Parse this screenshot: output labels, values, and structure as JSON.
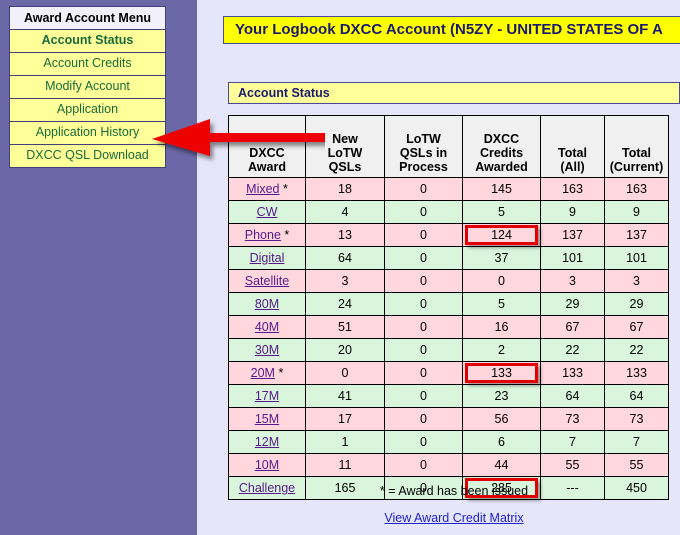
{
  "sidebar": {
    "header": "Award Account Menu",
    "items": [
      {
        "label": "Account Status",
        "bold": true
      },
      {
        "label": "Account Credits",
        "bold": false
      },
      {
        "label": "Modify Account",
        "bold": false
      },
      {
        "label": "Application",
        "bold": false
      },
      {
        "label": "Application History",
        "bold": false
      },
      {
        "label": "DXCC QSL Download",
        "bold": false
      }
    ]
  },
  "main": {
    "title": "Your Logbook DXCC Account (N5ZY - UNITED STATES OF A",
    "section_title": "Account Status",
    "footnote": "* = Award has been issued",
    "matrix_link": "View Award Credit Matrix",
    "columns": [
      "DXCC Award",
      "New LoTW QSLs",
      "LoTW QSLs in Process",
      "DXCC Credits Awarded",
      "Total (All)",
      "Total (Current)"
    ],
    "column_lines": [
      [
        "DXCC",
        "Award"
      ],
      [
        "New",
        "LoTW",
        "QSLs"
      ],
      [
        "LoTW",
        "QSLs in",
        "Process"
      ],
      [
        "DXCC",
        "Credits",
        "Awarded"
      ],
      [
        "Total",
        "(All)"
      ],
      [
        "Total",
        "(Current)"
      ]
    ],
    "rows": [
      {
        "award": "Mixed",
        "issued": true,
        "new_lotw": "18",
        "in_process": "0",
        "credits": "145",
        "total_all": "163",
        "total_current": "163",
        "highlight": false
      },
      {
        "award": "CW",
        "issued": false,
        "new_lotw": "4",
        "in_process": "0",
        "credits": "5",
        "total_all": "9",
        "total_current": "9",
        "highlight": false
      },
      {
        "award": "Phone",
        "issued": true,
        "new_lotw": "13",
        "in_process": "0",
        "credits": "124",
        "total_all": "137",
        "total_current": "137",
        "highlight": true
      },
      {
        "award": "Digital",
        "issued": false,
        "new_lotw": "64",
        "in_process": "0",
        "credits": "37",
        "total_all": "101",
        "total_current": "101",
        "highlight": false
      },
      {
        "award": "Satellite",
        "issued": false,
        "new_lotw": "3",
        "in_process": "0",
        "credits": "0",
        "total_all": "3",
        "total_current": "3",
        "highlight": false
      },
      {
        "award": "80M",
        "issued": false,
        "new_lotw": "24",
        "in_process": "0",
        "credits": "5",
        "total_all": "29",
        "total_current": "29",
        "highlight": false
      },
      {
        "award": "40M",
        "issued": false,
        "new_lotw": "51",
        "in_process": "0",
        "credits": "16",
        "total_all": "67",
        "total_current": "67",
        "highlight": false
      },
      {
        "award": "30M",
        "issued": false,
        "new_lotw": "20",
        "in_process": "0",
        "credits": "2",
        "total_all": "22",
        "total_current": "22",
        "highlight": false
      },
      {
        "award": "20M",
        "issued": true,
        "new_lotw": "0",
        "in_process": "0",
        "credits": "133",
        "total_all": "133",
        "total_current": "133",
        "highlight": true
      },
      {
        "award": "17M",
        "issued": false,
        "new_lotw": "41",
        "in_process": "0",
        "credits": "23",
        "total_all": "64",
        "total_current": "64",
        "highlight": false
      },
      {
        "award": "15M",
        "issued": false,
        "new_lotw": "17",
        "in_process": "0",
        "credits": "56",
        "total_all": "73",
        "total_current": "73",
        "highlight": false
      },
      {
        "award": "12M",
        "issued": false,
        "new_lotw": "1",
        "in_process": "0",
        "credits": "6",
        "total_all": "7",
        "total_current": "7",
        "highlight": false
      },
      {
        "award": "10M",
        "issued": false,
        "new_lotw": "11",
        "in_process": "0",
        "credits": "44",
        "total_all": "55",
        "total_current": "55",
        "highlight": false
      },
      {
        "award": "Challenge",
        "issued": false,
        "new_lotw": "165",
        "in_process": "0",
        "credits": "285",
        "total_all": "---",
        "total_current": "450",
        "highlight": true
      }
    ]
  },
  "annotation": {
    "arrow_color": "#EE0000",
    "arrow_points_to": "DXCC QSL Download",
    "highlight_color": "#E00000"
  },
  "colors": {
    "page_background": "#E6E6FA",
    "sidebar_background": "#6B68A8",
    "menu_item_background": "#FFFF99",
    "menu_item_text": "#1a6b3c",
    "title_background": "#FFFF00",
    "title_text": "#191970",
    "row_odd": "#FFD7DC",
    "row_even": "#D9F5DC",
    "header_background": "#F0F0F0"
  }
}
